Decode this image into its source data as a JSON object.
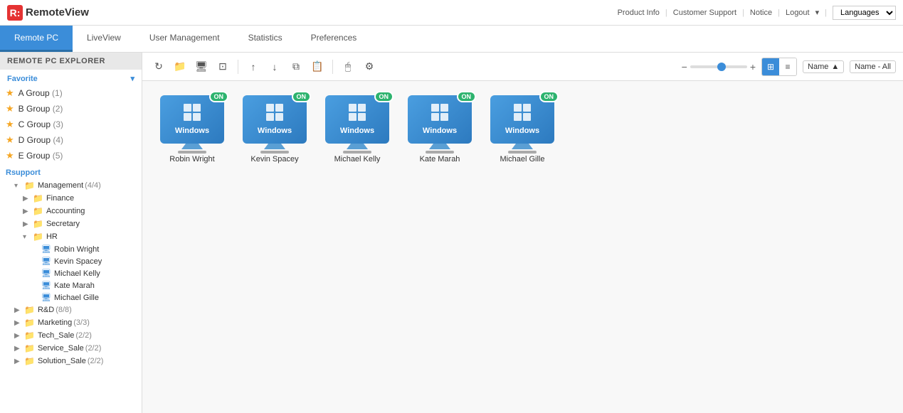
{
  "topbar": {
    "logo_letter": "R:",
    "logo_name": "RemoteView",
    "links": {
      "product_info": "Product Info",
      "customer_support": "Customer Support",
      "notice": "Notice",
      "logout": "Logout",
      "languages": "Languages"
    }
  },
  "nav": {
    "tabs": [
      {
        "id": "remote-pc",
        "label": "Remote PC",
        "active": true
      },
      {
        "id": "liveview",
        "label": "LiveView",
        "active": false
      },
      {
        "id": "user-management",
        "label": "User Management",
        "active": false
      },
      {
        "id": "statistics",
        "label": "Statistics",
        "active": false
      },
      {
        "id": "preferences",
        "label": "Preferences",
        "active": false
      }
    ]
  },
  "sidebar": {
    "header": "REMOTE PC EXPLORER",
    "favorite_label": "Favorite",
    "favorites": [
      {
        "label": "A Group",
        "count": "(1)"
      },
      {
        "label": "B Group",
        "count": "(2)"
      },
      {
        "label": "C Group",
        "count": "(3)"
      },
      {
        "label": "D Group",
        "count": "(4)"
      },
      {
        "label": "E Group",
        "count": "(5)"
      }
    ],
    "tree_section_label": "Rsupport",
    "tree": [
      {
        "label": "Management",
        "count": "(4/4)",
        "type": "folder",
        "indent": 0,
        "expanded": true
      },
      {
        "label": "Finance",
        "type": "folder",
        "indent": 1,
        "expanded": false
      },
      {
        "label": "Accounting",
        "type": "folder",
        "indent": 1,
        "expanded": false
      },
      {
        "label": "Secretary",
        "type": "folder",
        "indent": 1,
        "expanded": false
      },
      {
        "label": "HR",
        "type": "folder",
        "indent": 1,
        "expanded": true
      },
      {
        "label": "Robin Wright",
        "type": "pc",
        "indent": 2
      },
      {
        "label": "Kevin Spacey",
        "type": "pc",
        "indent": 2
      },
      {
        "label": "Michael Kelly",
        "type": "pc",
        "indent": 2
      },
      {
        "label": "Kate Marah",
        "type": "pc",
        "indent": 2
      },
      {
        "label": "Michael Gille",
        "type": "pc",
        "indent": 2
      },
      {
        "label": "R&D",
        "count": "(8/8)",
        "type": "folder",
        "indent": 0
      },
      {
        "label": "Marketing",
        "count": "(3/3)",
        "type": "folder",
        "indent": 0
      },
      {
        "label": "Tech_Sale",
        "count": "(2/2)",
        "type": "folder",
        "indent": 0
      },
      {
        "label": "Service_Sale",
        "count": "(2/2)",
        "type": "folder",
        "indent": 0
      },
      {
        "label": "Solution_Sale",
        "count": "(2/2)",
        "type": "folder",
        "indent": 0
      }
    ]
  },
  "toolbar": {
    "sort_label": "Name",
    "sort_arrow": "▲",
    "filter_label": "Name - All"
  },
  "pc_list": [
    {
      "name": "Robin Wright",
      "os": "Windows",
      "online": true
    },
    {
      "name": "Kevin Spacey",
      "os": "Windows",
      "online": true
    },
    {
      "name": "Michael Kelly",
      "os": "Windows",
      "online": true
    },
    {
      "name": "Kate Marah",
      "os": "Windows",
      "online": true
    },
    {
      "name": "Michael Gille",
      "os": "Windows",
      "online": true
    }
  ],
  "badge": {
    "on": "ON"
  }
}
